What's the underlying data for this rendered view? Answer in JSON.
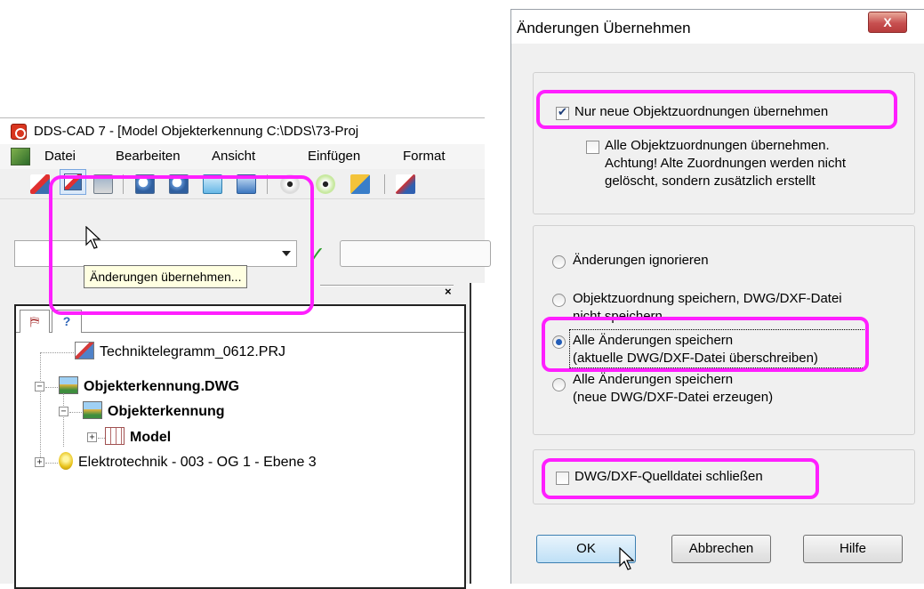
{
  "app_window": {
    "title": "DDS-CAD 7 - [Model  Objekterkennung  C:\\DDS\\73-Proj",
    "menu": [
      "Datei",
      "Bearbeiten",
      "Ansicht",
      "Einfügen",
      "Format"
    ],
    "tooltip": "Änderungen übernehmen...",
    "panel_close": "×",
    "tree_tabs": [
      "⛿",
      "?"
    ],
    "tree": [
      {
        "label": "Techniktelegramm_0612.PRJ",
        "bold": false
      },
      {
        "label": "Objekterkennung.DWG",
        "bold": true
      },
      {
        "label": "Objekterkennung",
        "bold": true
      },
      {
        "label": "Model",
        "bold": true
      },
      {
        "label": "Elektrotechnik - 003 - OG 1 - Ebene 3",
        "bold": false
      }
    ]
  },
  "dialog": {
    "title": "Änderungen Übernehmen",
    "close_label": "X",
    "checkbox_new_only": {
      "line1": "Nur neue Objektzuordnungen übernehmen",
      "checked": true
    },
    "checkbox_all": {
      "line1": "Alle Objektzuordnungen übernehmen.",
      "line2": "Achtung! Alte Zuordnungen werden nicht",
      "line3": "gelöscht, sondern zusätzlich erstellt",
      "checked": false
    },
    "radio_options": [
      {
        "line1": "Änderungen ignorieren",
        "line2": "",
        "checked": false
      },
      {
        "line1": "Objektzuordnung speichern, DWG/DXF-Datei",
        "line2": "nicht speichern",
        "checked": false
      },
      {
        "line1": "Alle Änderungen speichern",
        "line2": "(aktuelle DWG/DXF-Datei überschreiben)",
        "checked": true
      },
      {
        "line1": "Alle Änderungen speichern",
        "line2": "(neue DWG/DXF-Datei erzeugen)",
        "checked": false
      }
    ],
    "checkbox_close_source": {
      "label": "DWG/DXF-Quelldatei schließen",
      "checked": false
    },
    "buttons": {
      "ok": "OK",
      "cancel": "Abbrechen",
      "help": "Hilfe"
    }
  },
  "colors": {
    "highlight": "#ff1fff",
    "tooltip_bg": "#ffffe1"
  }
}
